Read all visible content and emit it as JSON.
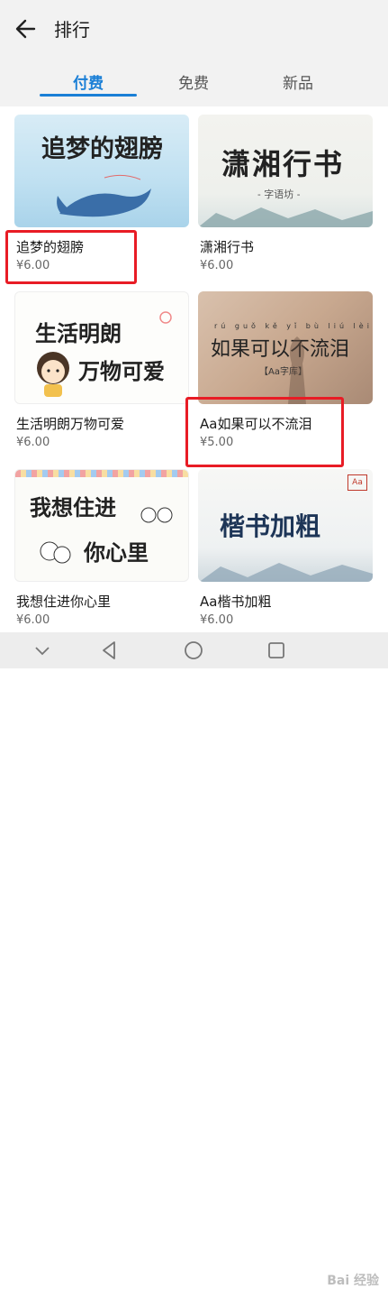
{
  "header": {
    "title": "排行",
    "back_icon": "arrow-left-icon"
  },
  "tabs": [
    {
      "label": "付费",
      "active": true
    },
    {
      "label": "免费",
      "active": false
    },
    {
      "label": "新品",
      "active": false
    }
  ],
  "cards": [
    {
      "name": "追梦的翅膀",
      "price": "¥6.00",
      "thumb_text": "追梦的翅膀",
      "highlighted": true
    },
    {
      "name": "潇湘行书",
      "price": "¥6.00",
      "thumb_text": "潇湘行书",
      "thumb_sub": "- 字语坊 -",
      "highlighted": false
    },
    {
      "name": "生活明朗万物可爱",
      "price": "¥6.00",
      "thumb_line1": "生活明朗",
      "thumb_line2": "万物可爱",
      "highlighted": false
    },
    {
      "name": "Aa如果可以不流泪",
      "price": "¥5.00",
      "thumb_text": "如果可以不流泪",
      "thumb_pinyin": "rú guǒ kě yǐ bù liú lèi",
      "thumb_sub": "【Aa字库】",
      "highlighted": true
    },
    {
      "name": "我想住进你心里",
      "price": "¥6.00",
      "thumb_line1": "我想住进",
      "thumb_line2": "你心里",
      "highlighted": false
    },
    {
      "name": "Aa楷书加粗",
      "price": "¥6.00",
      "thumb_text": "楷书加粗",
      "thumb_badge": "Aa",
      "highlighted": false
    }
  ],
  "navbar": {
    "icons": [
      "chevron-down-icon",
      "back-triangle-icon",
      "home-circle-icon",
      "recent-square-icon"
    ]
  },
  "watermark": "Bai 经验"
}
